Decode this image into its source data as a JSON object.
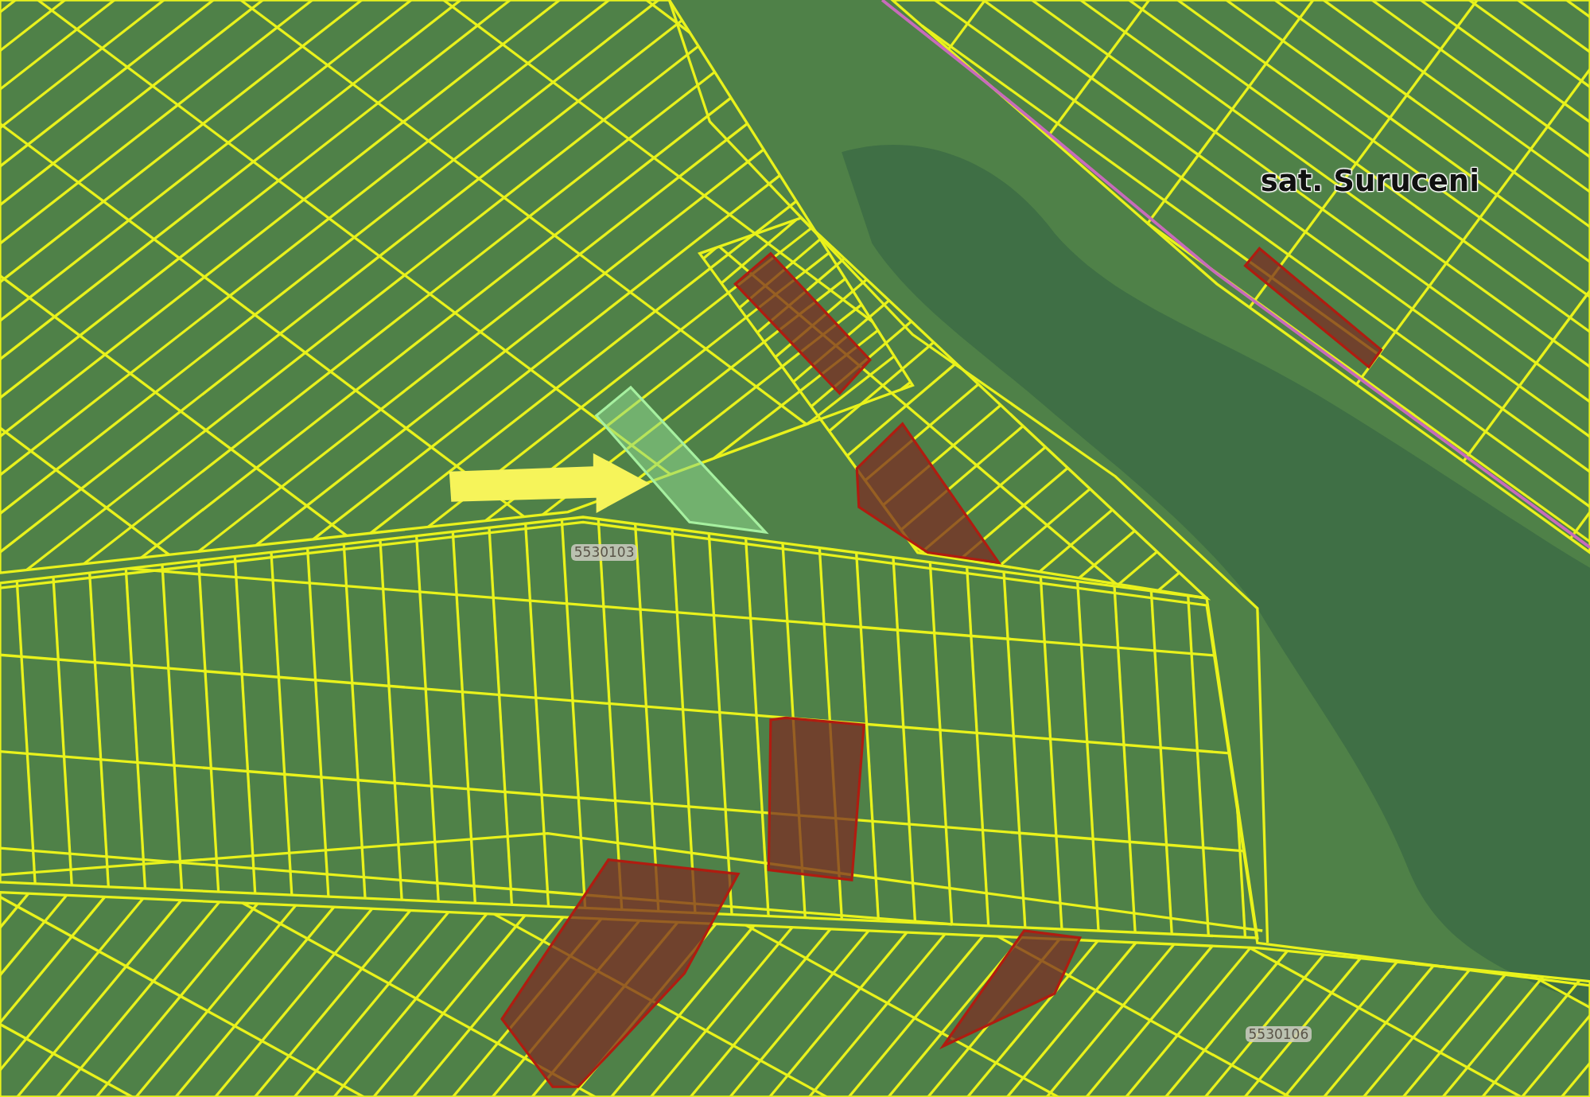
{
  "map": {
    "place_label": "sat. Suruceni",
    "sector_labels": [
      "5530103",
      "5530106"
    ],
    "parcels": [
      {
        "selected": false
      },
      {
        "selected": false
      },
      {
        "selected": false
      },
      {
        "selected": false
      },
      {
        "selected": false
      },
      {
        "selected": false
      },
      {
        "selected": true
      }
    ]
  }
}
